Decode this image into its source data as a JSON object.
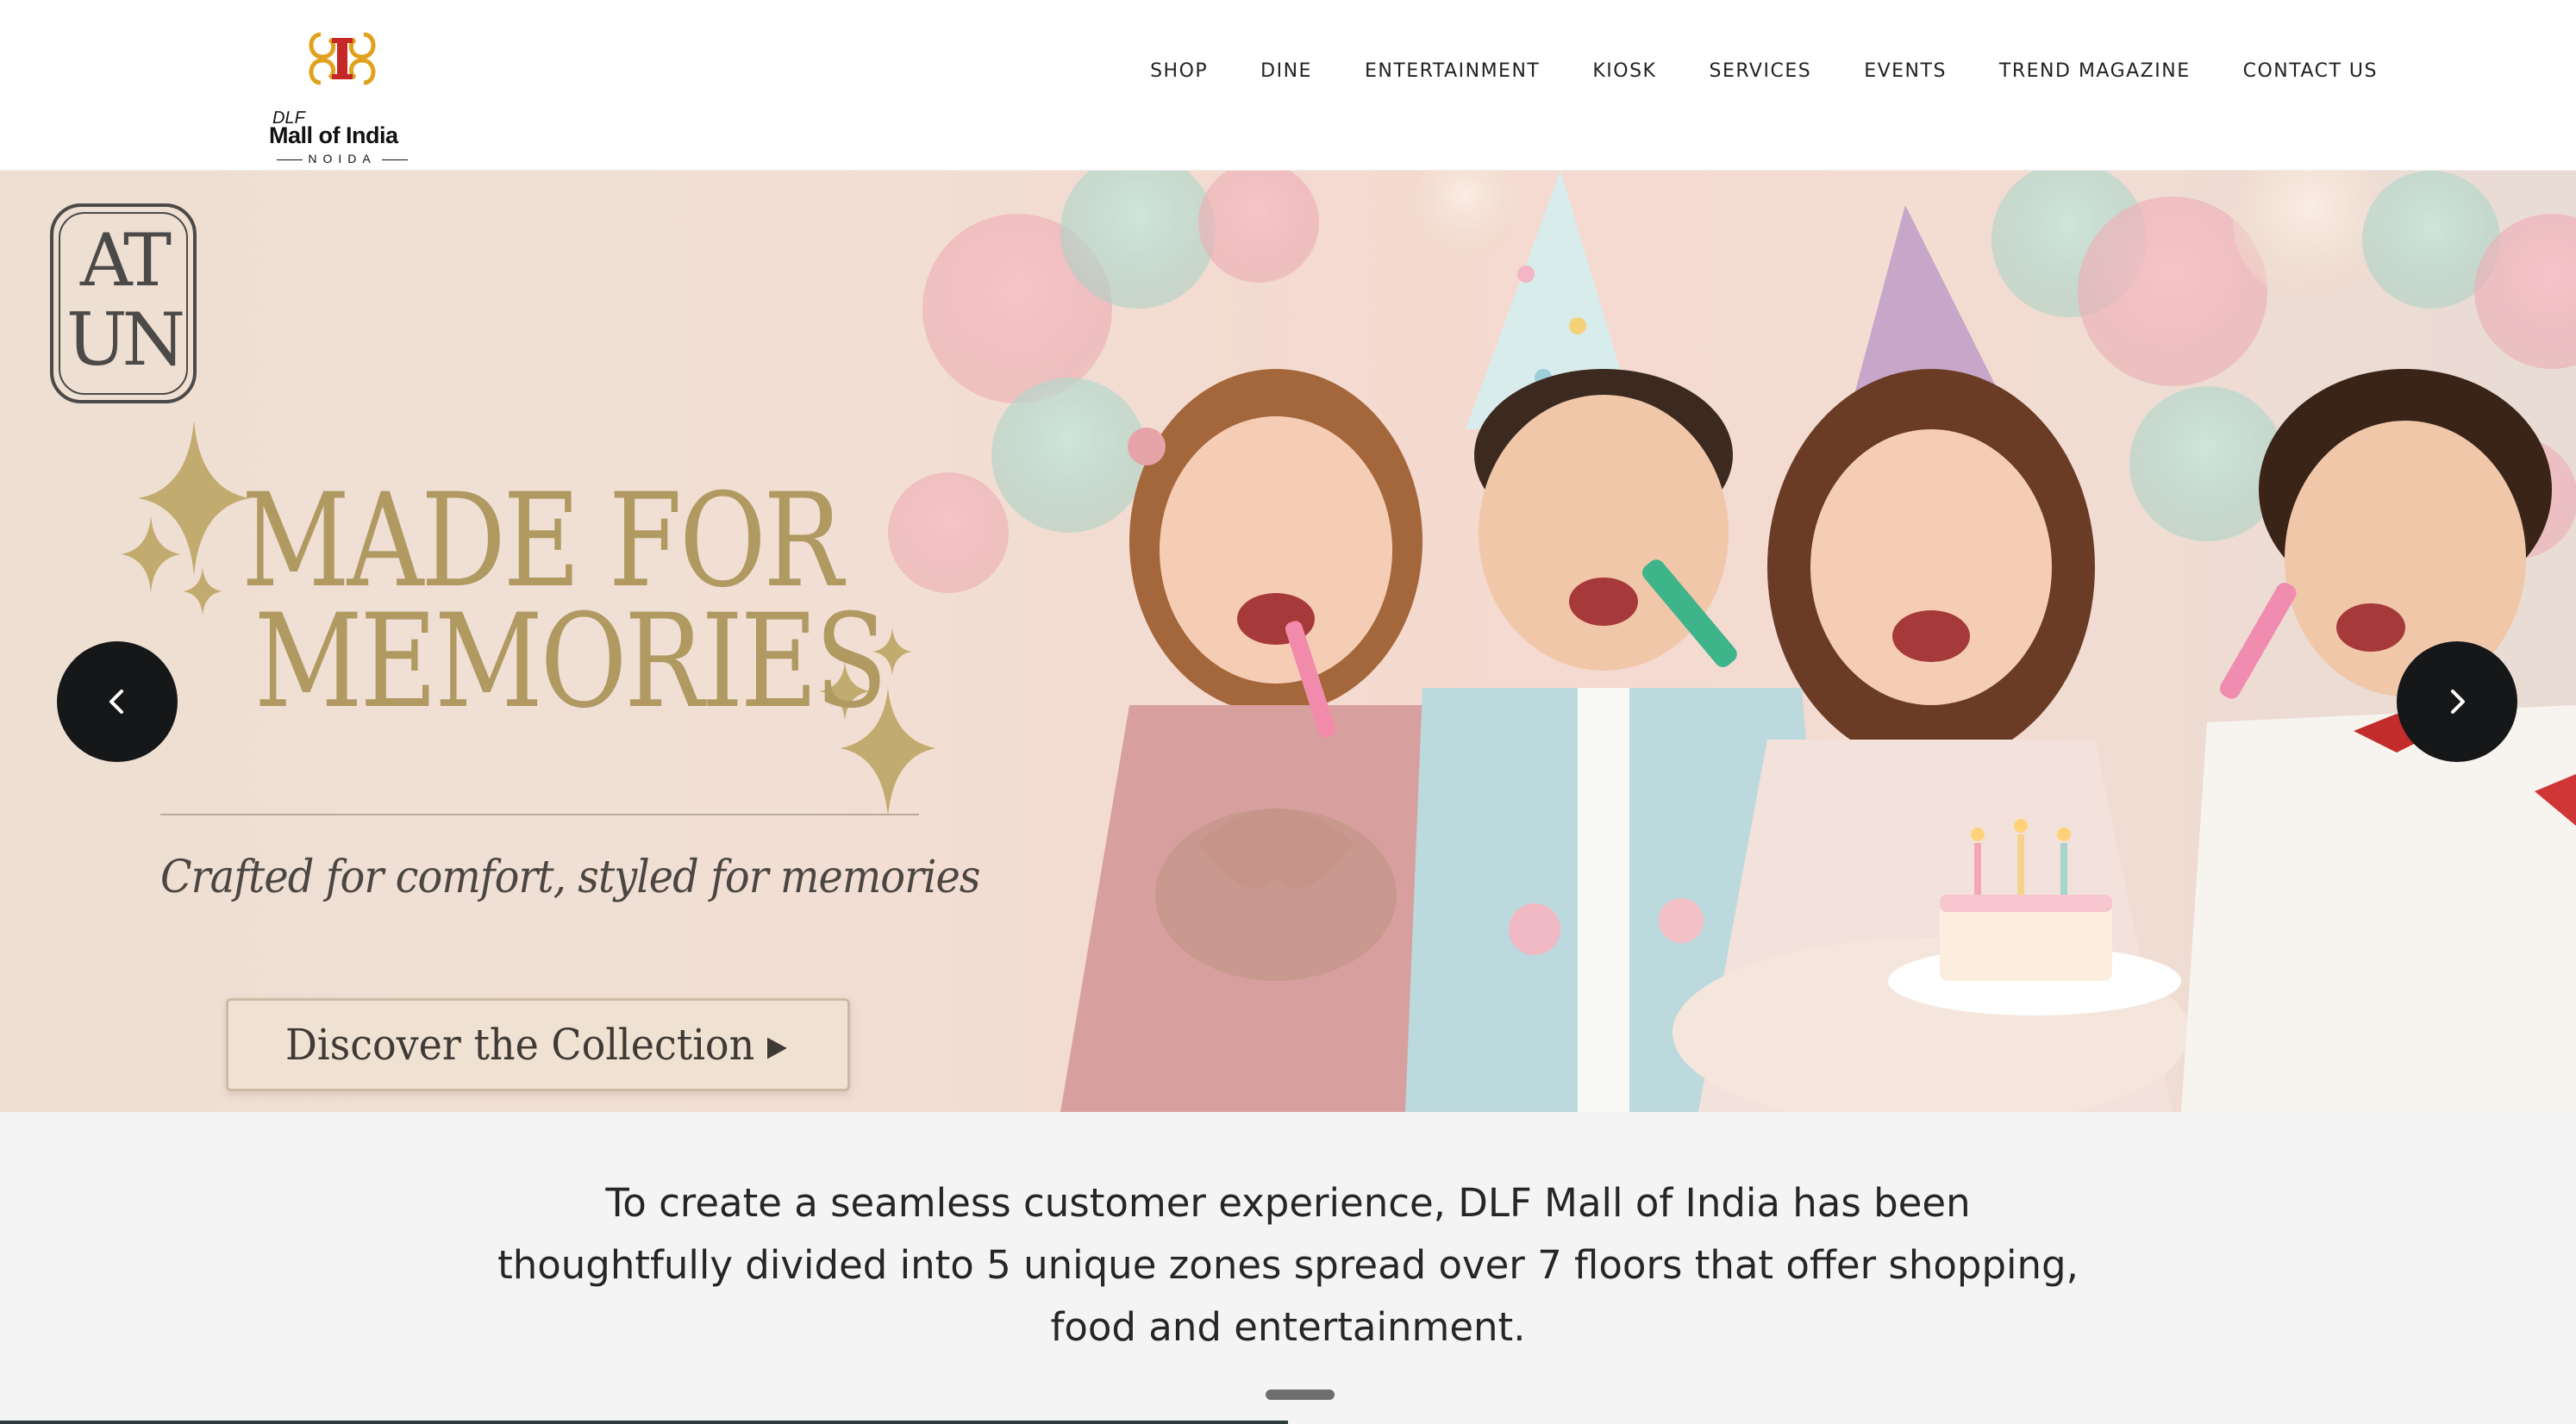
{
  "header": {
    "logo": {
      "brand_small": "DLF",
      "name": "Mall of India",
      "location": "NOIDA"
    },
    "nav": [
      {
        "label": "SHOP"
      },
      {
        "label": "DINE"
      },
      {
        "label": "ENTERTAINMENT"
      },
      {
        "label": "KIOSK"
      },
      {
        "label": "SERVICES"
      },
      {
        "label": "EVENTS"
      },
      {
        "label": "TREND MAGAZINE"
      },
      {
        "label": "CONTACT US"
      }
    ]
  },
  "hero": {
    "brand_line1": "AT",
    "brand_line2": "UN",
    "headline_line1": "MADE FOR",
    "headline_line2": "MEMORIES",
    "tagline": "Crafted for comfort, styled for memories",
    "cta_label": "Discover the Collection ▸",
    "prev_icon": "chevron-left-icon",
    "next_icon": "chevron-right-icon",
    "colors": {
      "gold": "#b09a62",
      "arrow_bg": "#161719"
    }
  },
  "info": {
    "text": "To create a seamless customer experience, DLF Mall of India has been thoughtfully divided into 5 unique zones spread over 7 floors that offer shopping, food and entertainment."
  }
}
